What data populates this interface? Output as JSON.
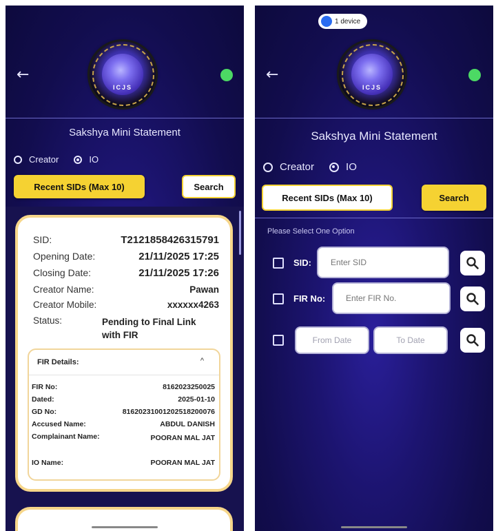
{
  "left": {
    "title": "Sakshya Mini Statement",
    "radio_creator": "Creator",
    "radio_io": "IO",
    "recent_btn": "Recent SIDs (Max 10)",
    "search_btn": "Search",
    "logo_text": "ICJS",
    "card": {
      "sid_label": "SID:",
      "sid_value": "T2121858426315791",
      "opening_label": "Opening Date:",
      "opening_value": "21/11/2025 17:25",
      "closing_label": "Closing Date:",
      "closing_value": "21/11/2025 17:26",
      "creator_name_label": "Creator Name:",
      "creator_name_value": "Pawan",
      "creator_mobile_label": "Creator Mobile:",
      "creator_mobile_value": "xxxxxx4263",
      "status_label": "Status:",
      "status_value": "Pending to Final Link with FIR",
      "fir_details": {
        "heading": "FIR Details:",
        "chevron": "^",
        "rows": [
          {
            "label": "FIR No:",
            "value": "8162023250025"
          },
          {
            "label": "Dated:",
            "value": "2025-01-10"
          },
          {
            "label": "GD No:",
            "value": "81620231001202518200076"
          },
          {
            "label": "Accused Name:",
            "value": "ABDUL DANISH"
          },
          {
            "label": "Complainant Name:",
            "value": "POORAN MAL JAT"
          },
          {
            "label": "IO Name:",
            "value": "POORAN MAL JAT"
          }
        ]
      }
    }
  },
  "right": {
    "device_pill": "1 device",
    "title": "Sakshya Mini Statement",
    "radio_creator": "Creator",
    "radio_io": "IO",
    "recent_btn": "Recent SIDs (Max 10)",
    "search_btn": "Search",
    "logo_text": "ICJS",
    "hint": "Please Select One Option",
    "sid_label": "SID:",
    "sid_placeholder": "Enter SID",
    "fir_label": "FIR No:",
    "fir_placeholder": "Enter FIR No.",
    "from_date": "From Date",
    "to_date": "To Date"
  },
  "colors": {
    "accent_yellow": "#f5d232",
    "background_navy": "#1c1470",
    "status_green": "#4cd964"
  },
  "icons": [
    "back-arrow-icon",
    "status-online-icon",
    "search-icon",
    "device-icon"
  ]
}
